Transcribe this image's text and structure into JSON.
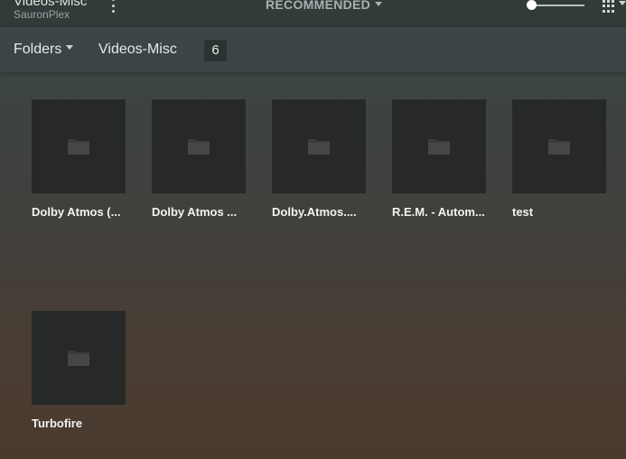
{
  "header": {
    "library_title": "Videos-Misc",
    "server_name": "SauronPlex",
    "view_mode": "RECOMMENDED"
  },
  "subheader": {
    "filter_label": "Folders",
    "breadcrumb": "Videos-Misc",
    "item_count": "6"
  },
  "folders": [
    {
      "title": "Dolby Atmos (..."
    },
    {
      "title": "Dolby Atmos ..."
    },
    {
      "title": "Dolby.Atmos...."
    },
    {
      "title": "R.E.M. - Autom..."
    },
    {
      "title": "test"
    },
    {
      "title": "Turbofire"
    }
  ],
  "icons": {
    "folder": "folder-icon",
    "more": "more-vertical-icon",
    "grid": "grid-view-icon"
  },
  "colors": {
    "tile_bg": "#262927",
    "icon": "#3a3d3b"
  }
}
